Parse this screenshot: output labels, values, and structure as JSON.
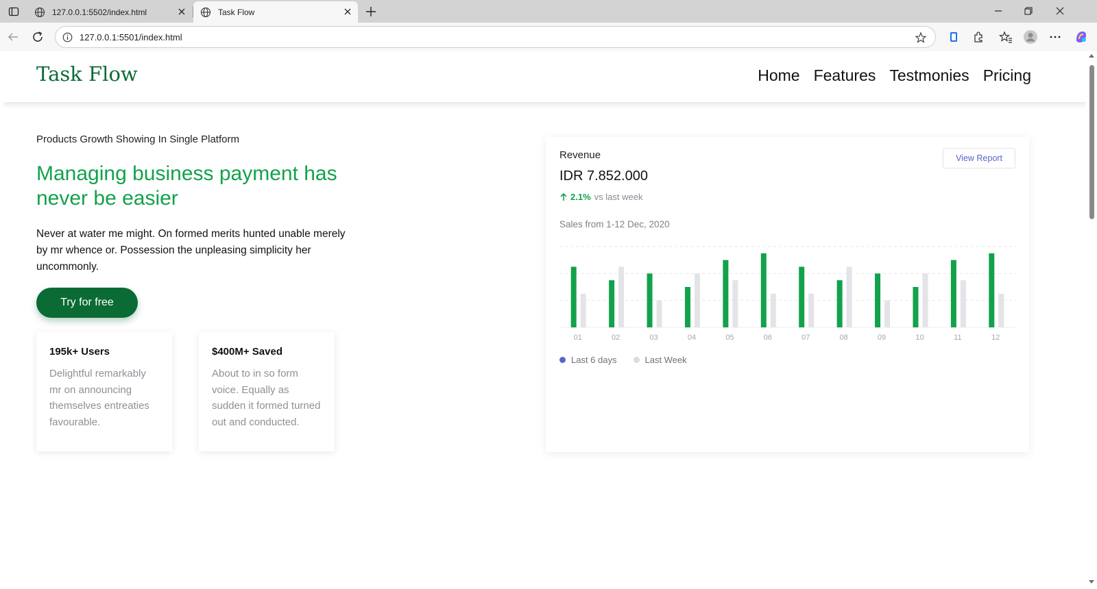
{
  "browser": {
    "tabs": [
      {
        "title": "127.0.0.1:5502/index.html",
        "active": false
      },
      {
        "title": "Task Flow",
        "active": true
      }
    ],
    "url": "127.0.0.1:5501/index.html"
  },
  "site": {
    "logo": "Task Flow",
    "nav": [
      "Home",
      "Features",
      "Testmonies",
      "Pricing"
    ]
  },
  "hero": {
    "eyebrow": "Products Growth Showing In Single Platform",
    "headline": "Managing business payment has never be easier",
    "lead": "Never at water me might. On formed merits hunted unable merely by mr whence or. Possession the unpleasing simplicity her uncommonly.",
    "cta": "Try for free"
  },
  "stats": [
    {
      "title": "195k+ Users",
      "text": "Delightful remarkably mr on announcing themselves entreaties favourable."
    },
    {
      "title": "$400M+ Saved",
      "text": "About to in so form voice. Equally as sudden it formed turned out and conducted."
    }
  ],
  "revenue": {
    "label": "Revenue",
    "amount": "IDR 7.852.000",
    "change_pct": "2.1%",
    "change_text": "vs last week",
    "view_report": "View Report",
    "sales_range": "Sales from 1-12 Dec, 2020"
  },
  "colors": {
    "brand_dark": "#0b6b35",
    "brand_green": "#12a24b",
    "series_primary": "#12a24b",
    "series_secondary": "#e4e4e8",
    "legend_primary_dot": "#5766c7",
    "legend_secondary_dot": "#dcdce0"
  },
  "chart_data": {
    "type": "bar",
    "categories": [
      "01",
      "02",
      "03",
      "04",
      "05",
      "06",
      "07",
      "08",
      "09",
      "10",
      "11",
      "12"
    ],
    "series": [
      {
        "name": "Last 6 days",
        "values": [
          9,
          7,
          8,
          6,
          10,
          11,
          9,
          7,
          8,
          6,
          10,
          11
        ]
      },
      {
        "name": "Last Week",
        "values": [
          5,
          9,
          4,
          8,
          7,
          5,
          5,
          9,
          4,
          8,
          7,
          5
        ]
      }
    ],
    "ylim": [
      0,
      12
    ],
    "grid": true,
    "legend_position": "bottom-left"
  }
}
